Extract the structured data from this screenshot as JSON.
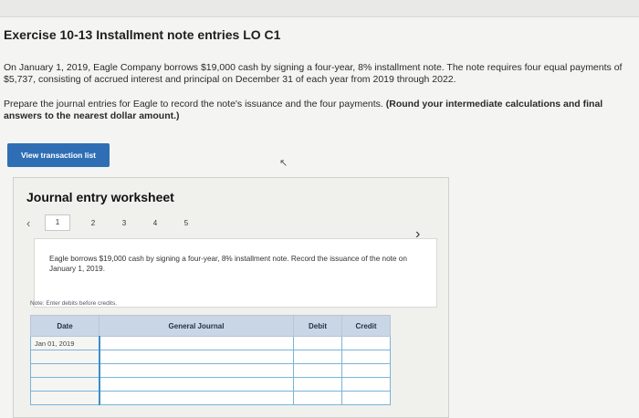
{
  "exercise": {
    "title": "Exercise 10-13 Installment note entries LO C1",
    "paragraph1": "On January 1, 2019, Eagle Company borrows $19,000 cash by signing a four-year, 8% installment note. The note requires four equal payments of $5,737, consisting of accrued interest and principal on December 31 of each year from 2019 through 2022.",
    "paragraph2_normal": "Prepare the journal entries for Eagle to record the note's issuance and the four payments.",
    "paragraph2_bold": "(Round your intermediate calculations and final answers to the nearest dollar amount.)"
  },
  "button": {
    "view_transaction_list": "View transaction list"
  },
  "worksheet": {
    "title": "Journal entry worksheet",
    "tabs": [
      "1",
      "2",
      "3",
      "4",
      "5"
    ],
    "active_tab": "1",
    "description": "Eagle borrows $19,000 cash by signing a four-year, 8% installment note. Record the issuance of the note on January 1, 2019.",
    "note": "Note: Enter debits before credits.",
    "columns": {
      "date": "Date",
      "general_journal": "General Journal",
      "debit": "Debit",
      "credit": "Credit"
    },
    "rows": [
      {
        "date": "Jan 01, 2019",
        "account": "",
        "debit": "",
        "credit": ""
      },
      {
        "date": "",
        "account": "",
        "debit": "",
        "credit": ""
      },
      {
        "date": "",
        "account": "",
        "debit": "",
        "credit": ""
      },
      {
        "date": "",
        "account": "",
        "debit": "",
        "credit": ""
      },
      {
        "date": "",
        "account": "",
        "debit": "",
        "credit": ""
      }
    ]
  },
  "icons": {
    "prev": "chevron-left-icon",
    "next": "chevron-right-icon"
  },
  "colors": {
    "button": "#2f6eb5",
    "table_header": "#c8d6e6",
    "input_border": "#7ab4d8"
  }
}
